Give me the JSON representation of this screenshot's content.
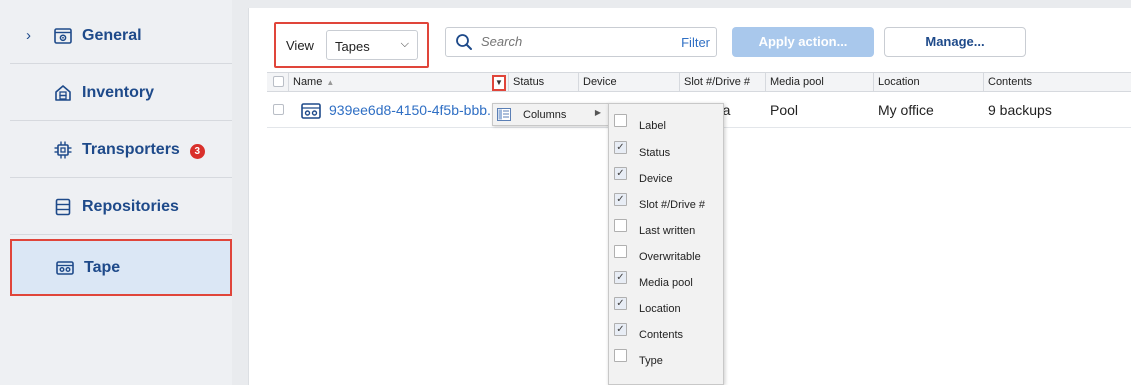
{
  "sidebar": {
    "items": [
      {
        "label": "General",
        "icon": "gear-box-icon",
        "has_chevron": true
      },
      {
        "label": "Inventory",
        "icon": "inventory-icon"
      },
      {
        "label": "Transporters",
        "icon": "chip-icon",
        "badge": "3"
      },
      {
        "label": "Repositories",
        "icon": "repository-icon"
      },
      {
        "label": "Tape",
        "icon": "tape-icon",
        "active": true
      }
    ],
    "chevron": "›"
  },
  "toolbar": {
    "view_label": "View",
    "view_value": "Tapes",
    "search_placeholder": "Search",
    "filter_label": "Filter",
    "apply_label": "Apply action...",
    "manage_label": "Manage..."
  },
  "table": {
    "columns": [
      "Name",
      "Status",
      "Device",
      "Slot #/Drive #",
      "Media pool",
      "Location",
      "Contents"
    ],
    "rows": [
      {
        "name": "939ee6d8-4150-4f5b-bbb...",
        "slot_partial": "ata",
        "media_pool": "Pool",
        "location": "My office",
        "contents": "9 backups"
      }
    ]
  },
  "context_menu": {
    "label": "Columns",
    "items": [
      {
        "label": "Label",
        "checked": false
      },
      {
        "label": "Status",
        "checked": true
      },
      {
        "label": "Device",
        "checked": true
      },
      {
        "label": "Slot #/Drive #",
        "checked": true
      },
      {
        "label": "Last written",
        "checked": false
      },
      {
        "label": "Overwritable",
        "checked": false
      },
      {
        "label": "Media pool",
        "checked": true
      },
      {
        "label": "Location",
        "checked": true
      },
      {
        "label": "Contents",
        "checked": true
      },
      {
        "label": "Type",
        "checked": false
      }
    ]
  },
  "colors": {
    "accent": "#1e4a8a",
    "link": "#2f6fc4",
    "highlight_border": "#e0453a",
    "badge": "#d9302b",
    "apply_disabled": "#a9c8ec"
  }
}
